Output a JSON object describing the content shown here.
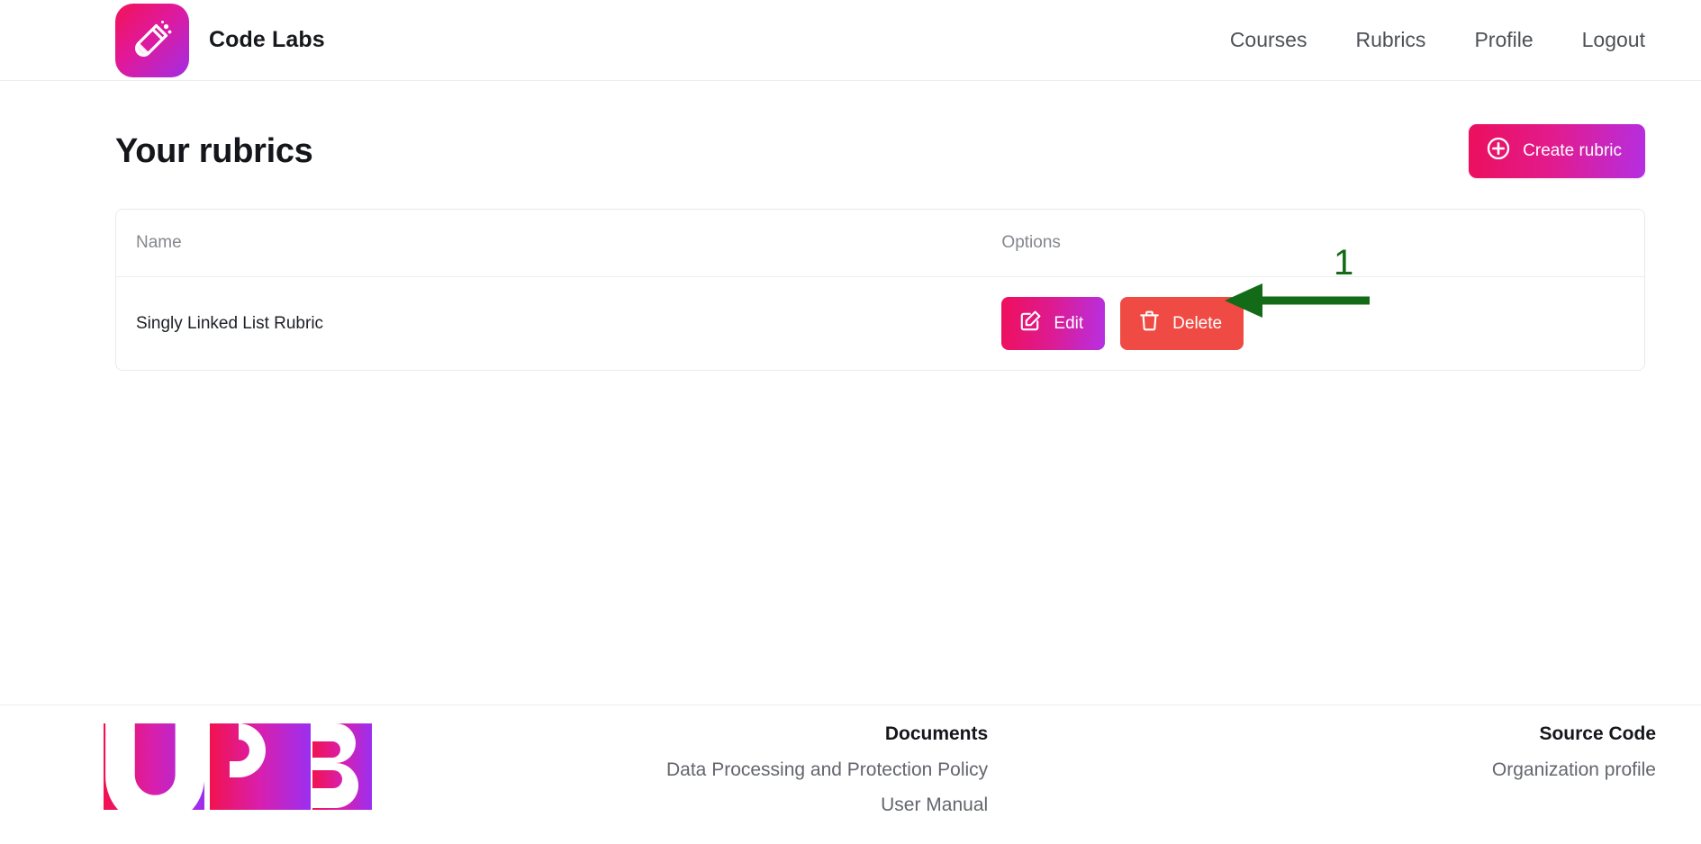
{
  "header": {
    "brand_name": "Code Labs",
    "logo_icon": "test-tube-icon",
    "nav": [
      {
        "label": "Courses",
        "icon": ""
      },
      {
        "label": "Rubrics",
        "icon": ""
      },
      {
        "label": "Profile",
        "icon": ""
      },
      {
        "label": "Logout",
        "icon": ""
      }
    ]
  },
  "main": {
    "page_title": "Your rubrics",
    "create_button": {
      "label": "Create rubric",
      "icon": "plus-circle-icon"
    },
    "table": {
      "columns": [
        "Name",
        "Options"
      ],
      "rows": [
        {
          "name": "Singly Linked List Rubric",
          "edit_label": "Edit",
          "edit_icon": "pencil-square-icon",
          "delete_label": "Delete",
          "delete_icon": "trash-icon"
        }
      ]
    }
  },
  "annotation": {
    "step_number": "1",
    "arrow_direction": "left",
    "color": "#136b17",
    "points_at": "delete-button"
  },
  "footer": {
    "logo_text": "UPB",
    "documents": {
      "title": "Documents",
      "links": [
        "Data Processing and Protection Policy",
        "User Manual"
      ]
    },
    "source_code": {
      "title": "Source Code",
      "links": [
        "Organization profile"
      ]
    }
  },
  "colors": {
    "brand_pink": "#ec0f5c",
    "brand_purple": "#b52ee2",
    "danger_red": "#ef4b44",
    "annotation_green": "#136b17",
    "text_muted": "#84878e"
  }
}
